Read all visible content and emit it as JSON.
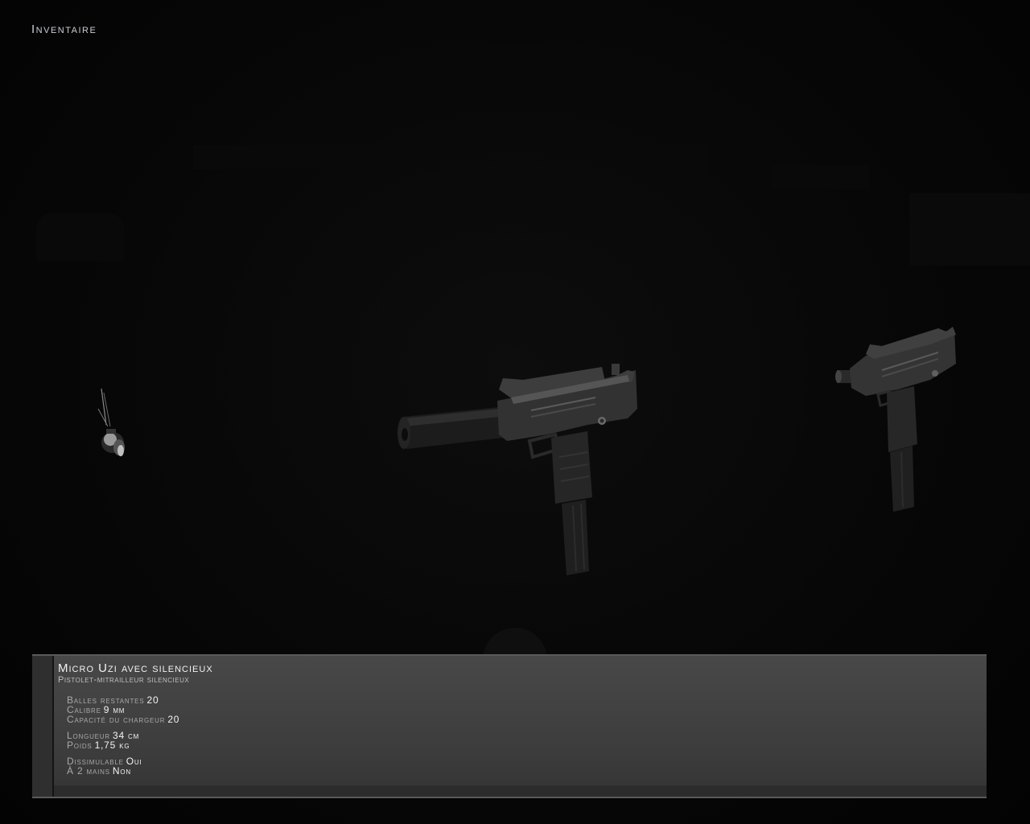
{
  "screen": {
    "title": "Inventaire"
  },
  "carousel": {
    "items": [
      {
        "name": "Gadget",
        "icon": "gadget-icon"
      },
      {
        "name": "Micro Uzi avec silencieux",
        "icon": "silenced-uzi-icon",
        "selected": true
      },
      {
        "name": "Micro Uzi",
        "icon": "uzi-icon"
      }
    ]
  },
  "info": {
    "name": "Micro Uzi avec silencieux",
    "type": "Pistolet-mitrailleur silencieux",
    "stats": {
      "ammo_left": {
        "label": "Balles restantes",
        "value": "20"
      },
      "caliber": {
        "label": "Calibre",
        "value": "9 mm"
      },
      "magazine": {
        "label": "Capacité du chargeur",
        "value": "20"
      },
      "length": {
        "label": "Longueur",
        "value": "34 cm"
      },
      "weight": {
        "label": "Poids",
        "value": "1,75 kg"
      },
      "concealable": {
        "label": "Dissimulable",
        "value": "Oui"
      },
      "two_handed": {
        "label": "À 2 mains",
        "value": "Non"
      }
    }
  },
  "colors": {
    "panel": "#404040",
    "text_primary": "#f2f2f2",
    "text_secondary": "#a8a8a8"
  }
}
